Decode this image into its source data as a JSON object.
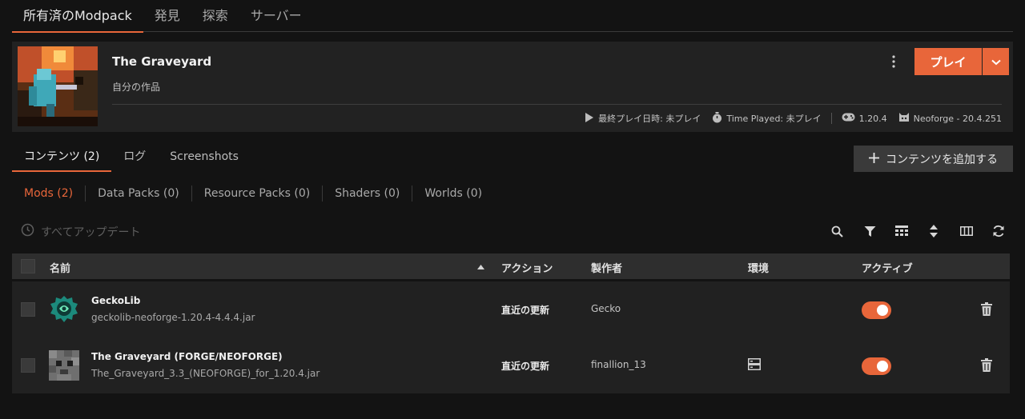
{
  "top_tabs": [
    {
      "label": "所有済のModpack"
    },
    {
      "label": "発見"
    },
    {
      "label": "探索"
    },
    {
      "label": "サーバー"
    }
  ],
  "instance": {
    "title": "The Graveyard",
    "subtitle": "自分の作品",
    "play_label": "プレイ",
    "last_played": "最終プレイ日時: 未プレイ",
    "time_played": "Time Played: 未プレイ",
    "game_version": "1.20.4",
    "loader": "Neoforge - 20.4.251"
  },
  "content_tabs": [
    {
      "label": "コンテンツ (2)"
    },
    {
      "label": "ログ"
    },
    {
      "label": "Screenshots"
    }
  ],
  "add_content_label": "コンテンツを追加する",
  "sub_tabs": [
    {
      "label": "Mods (2)"
    },
    {
      "label": "Data Packs (0)"
    },
    {
      "label": "Resource Packs (0)"
    },
    {
      "label": "Shaders (0)"
    },
    {
      "label": "Worlds (0)"
    }
  ],
  "update_all_label": "すべてアップデート",
  "toolbar_icons": [
    "search-icon",
    "filter-icon",
    "grid-view-icon",
    "sort-icon",
    "columns-icon",
    "refresh-icon"
  ],
  "table": {
    "headers": {
      "name": "名前",
      "action": "アクション",
      "author": "製作者",
      "environment": "環境",
      "active": "アクティブ"
    },
    "rows": [
      {
        "name": "GeckoLib",
        "file": "geckolib-neoforge-1.20.4-4.4.4.jar",
        "action": "直近の更新",
        "author": "Gecko",
        "active": true
      },
      {
        "name": "The Graveyard (FORGE/NEOFORGE)",
        "file": "The_Graveyard_3.3_(NEOFORGE)_for_1.20.4.jar",
        "action": "直近の更新",
        "author": "finallion_13",
        "active": true
      }
    ]
  },
  "colors": {
    "accent": "#e8663a",
    "background": "#131313",
    "panel": "#222222"
  }
}
